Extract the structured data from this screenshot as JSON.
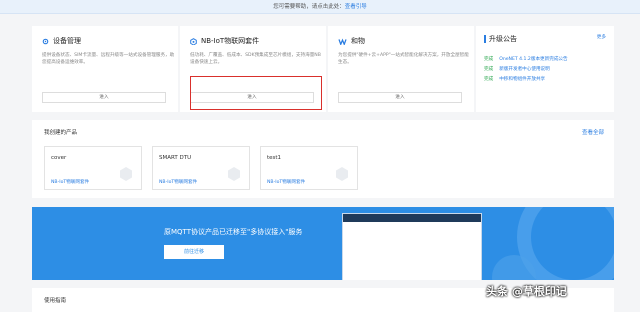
{
  "topbar": {
    "text": "您可需要帮助，请点击此处：",
    "link": "查看引导"
  },
  "services": [
    {
      "title": "设备管理",
      "desc": "提供设备状态、SIM卡流量、远程升级等一站式设备管理服务，助您提高设备运维效率。",
      "button": "进入",
      "icon": "gear-icon"
    },
    {
      "title": "NB-IoT物联网套件",
      "desc": "低功耗、广覆盖、低成本、SDK预集成至芯片模组，支持海量NB设备快速上云。",
      "button": "进入",
      "icon": "nb-iot-icon"
    },
    {
      "title": "和物",
      "desc": "为您提供\"硬件+云+APP\"一站式智能化解决方案，开放全屋智能生态。",
      "button": "进入",
      "icon": "hewu-logo-icon"
    }
  ],
  "announcements": {
    "title": "升级公告",
    "more": "更多",
    "items": [
      {
        "tag": "完成",
        "text": "OneNET 4.1.2版本更新完成公告"
      },
      {
        "tag": "完成",
        "text": "新版开发者中心使用说明"
      },
      {
        "tag": "完成",
        "text": "中移和物组件开放共享"
      }
    ]
  },
  "products": {
    "title": "我创建的产品",
    "view_all": "查看全部",
    "items": [
      {
        "name": "cover",
        "type": "NB-IoT物联网套件"
      },
      {
        "name": "SMART DTU",
        "type": "NB-IoT物联网套件"
      },
      {
        "name": "test1",
        "type": "NB-IoT物联网套件"
      }
    ]
  },
  "banner": {
    "headline": "原MQTT协议产品已迁移至\"多协议接入\"服务",
    "cta": "前往迁移"
  },
  "guide": {
    "title": "使用指南"
  },
  "watermark": "头条 @草根印记",
  "colors": {
    "accent": "#2a7de1",
    "banner": "#2d8ee5",
    "highlight": "#d9302c",
    "done": "#2aa64e"
  }
}
